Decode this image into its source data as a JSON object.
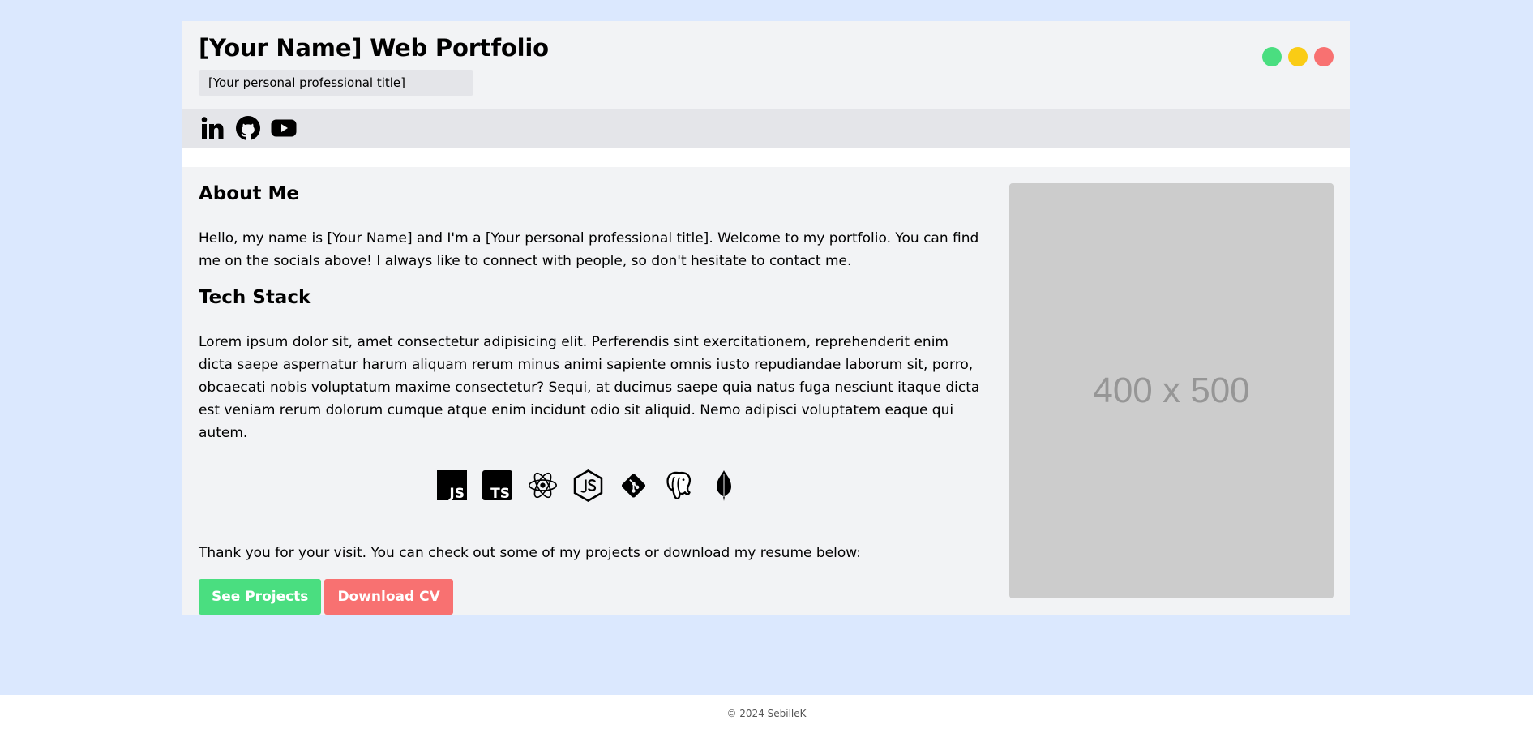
{
  "header": {
    "title": "[Your Name] Web Portfolio",
    "subtitle": "[Your personal professional title]",
    "window_controls": [
      {
        "name": "green-dot",
        "color": "#4ade80"
      },
      {
        "name": "yellow-dot",
        "color": "#facc15"
      },
      {
        "name": "red-dot",
        "color": "#f87171"
      }
    ]
  },
  "social": [
    {
      "icon": "linkedin-icon"
    },
    {
      "icon": "github-icon"
    },
    {
      "icon": "youtube-icon"
    }
  ],
  "about": {
    "heading": "About Me",
    "text": "Hello, my name is [Your Name] and I'm a [Your personal professional title]. Welcome to my portfolio. You can find me on the socials above! I always like to connect with people, so don't hesitate to contact me."
  },
  "tech": {
    "heading": "Tech Stack",
    "text": "Lorem ipsum dolor sit, amet consectetur adipisicing elit. Perferendis sint exercitationem, reprehenderit enim dicta saepe aspernatur harum aliquam rerum minus animi sapiente omnis iusto repudiandae laborum sit, porro, obcaecati nobis voluptatum maxime consectetur? Sequi, at ducimus saepe quia natus fuga nesciunt itaque dicta est veniam rerum dolorum cumque atque enim incidunt odio sit aliquid. Nemo adipisci voluptatem eaque qui autem.",
    "icons": [
      "javascript-icon",
      "typescript-icon",
      "react-icon",
      "nodejs-icon",
      "git-icon",
      "postgresql-icon",
      "mongodb-icon"
    ],
    "js_label": "JS",
    "ts_label": "TS"
  },
  "closing": {
    "text": "Thank you for your visit. You can check out some of my projects or download my resume below:",
    "projects_button": "See Projects",
    "cv_button": "Download CV"
  },
  "image_placeholder": {
    "label": "400 x 500"
  },
  "footer": {
    "text": "© 2024 SebilleK"
  },
  "colors": {
    "page_bg": "#dbe8fe",
    "panel_bg": "#f2f3f5",
    "accent_green": "#4ade80",
    "accent_red": "#f87171",
    "accent_yellow": "#facc15"
  }
}
